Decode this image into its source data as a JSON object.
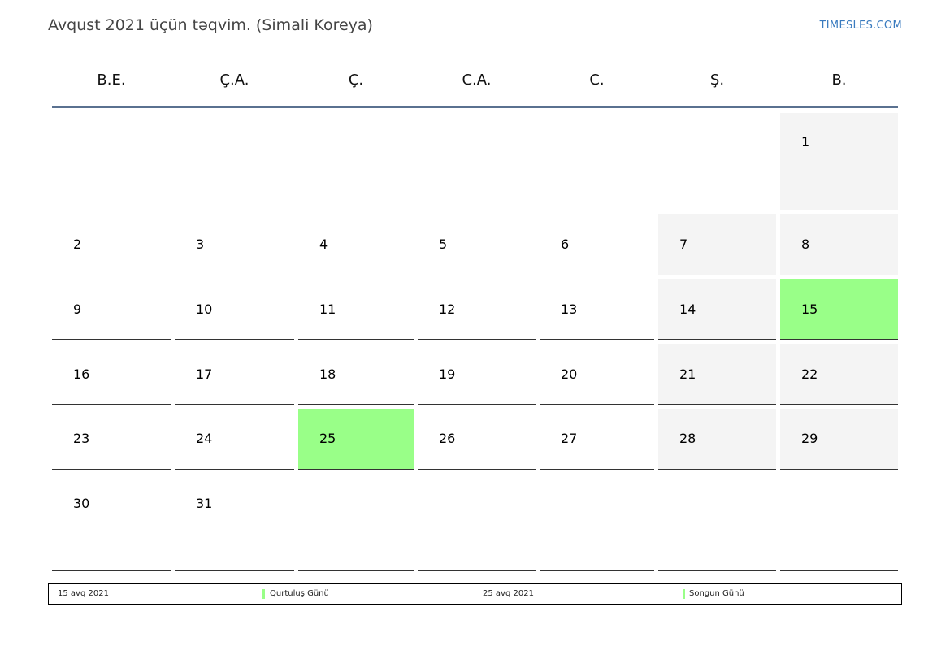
{
  "header": {
    "title": "Avqust 2021 üçün təqvim. (Simali Koreya)",
    "brand": "TIMESLES.COM"
  },
  "weekdays": [
    "B.E.",
    "Ç.A.",
    "Ç.",
    "C.A.",
    "C.",
    "Ş.",
    "B."
  ],
  "weeks": [
    [
      "",
      "",
      "",
      "",
      "",
      "",
      "1"
    ],
    [
      "2",
      "3",
      "4",
      "5",
      "6",
      "7",
      "8"
    ],
    [
      "9",
      "10",
      "11",
      "12",
      "13",
      "14",
      "15"
    ],
    [
      "16",
      "17",
      "18",
      "19",
      "20",
      "21",
      "22"
    ],
    [
      "23",
      "24",
      "25",
      "26",
      "27",
      "28",
      "29"
    ],
    [
      "30",
      "31",
      "",
      "",
      "",
      "",
      ""
    ]
  ],
  "holidays": [
    "15",
    "25"
  ],
  "colors": {
    "holiday": "#99ff88",
    "weekend": "#f4f4f4",
    "header_line": "#5a7190",
    "brand": "#3a7bbf"
  },
  "legend": [
    {
      "date": "15 avq 2021",
      "name": "Qurtuluş Günü"
    },
    {
      "date": "25 avq 2021",
      "name": "Songun Günü"
    }
  ]
}
